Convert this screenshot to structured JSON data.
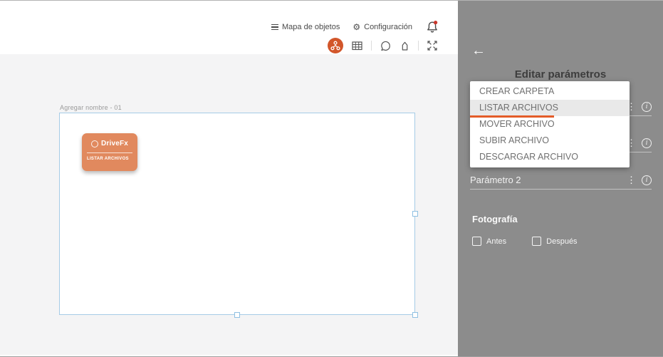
{
  "toolbar": {
    "map_label": "Mapa de objetos",
    "config_label": "Configuración"
  },
  "icons": {
    "gear": "⚙",
    "back_arrow": "←",
    "kebab": "⋮",
    "info": "i"
  },
  "canvas": {
    "group_label": "Agregar nombre - 01",
    "card": {
      "title": "DriveFx",
      "action": "LISTAR ARCHIVOS"
    }
  },
  "panel": {
    "title": "Editar parámetros",
    "param2_label": "Parámetro 2",
    "photo": {
      "title": "Fotografía",
      "options": [
        "Antes",
        "Después"
      ]
    }
  },
  "dropdown": {
    "items": [
      {
        "label": "CREAR CARPETA",
        "selected": false
      },
      {
        "label": "LISTAR ARCHIVOS",
        "selected": true
      },
      {
        "label": "MOVER ARCHIVO",
        "selected": false
      },
      {
        "label": "SUBIR ARCHIVO",
        "selected": false
      },
      {
        "label": "DESCARGAR ARCHIVO",
        "selected": false
      }
    ]
  },
  "colors": {
    "accent_orange": "#e45c28",
    "card_orange": "#e1895e",
    "selection_blue": "#a5cbe6",
    "panel_gray": "#8c8c8c",
    "notification_red": "#c9372c"
  }
}
